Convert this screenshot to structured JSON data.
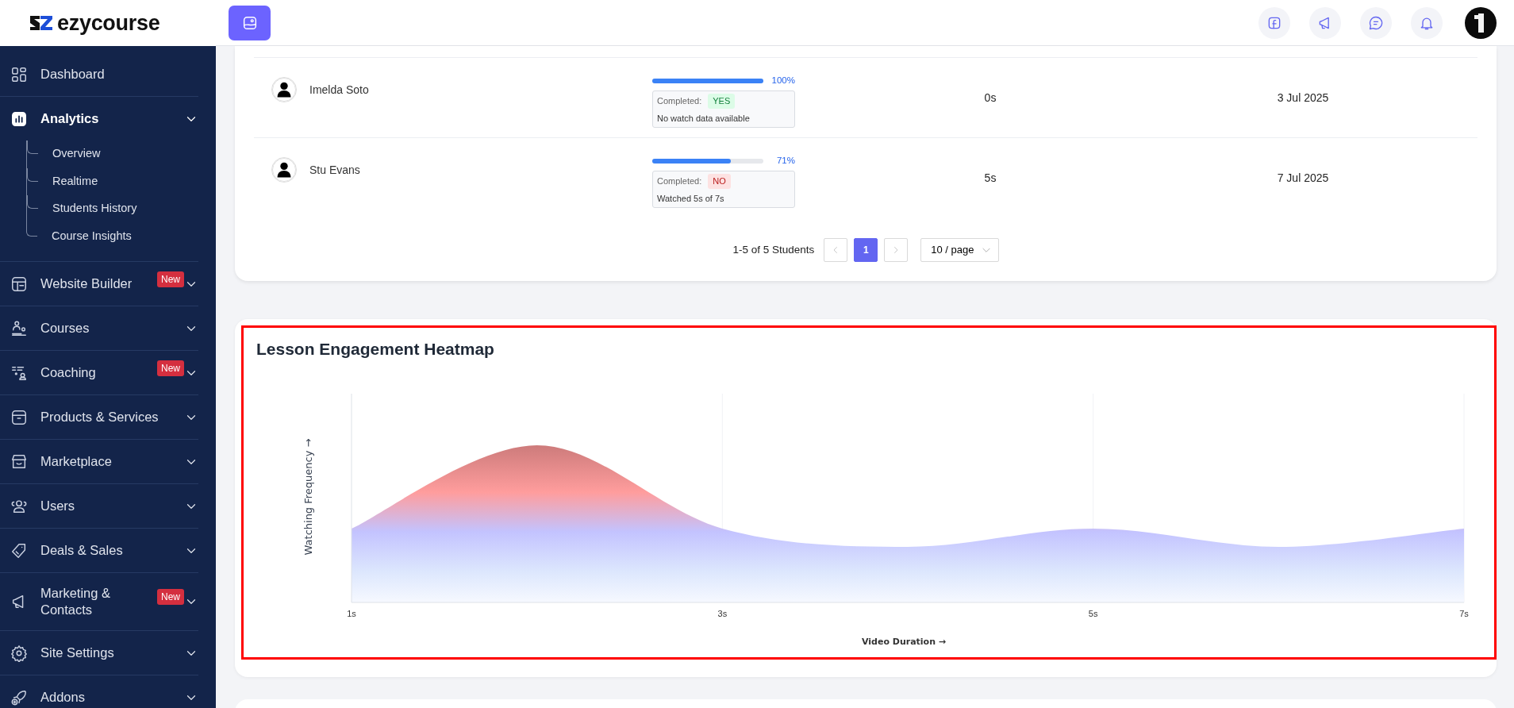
{
  "logo": {
    "text": "ezycourse"
  },
  "sidebar": {
    "items": [
      {
        "label": "Dashboard",
        "selected": false,
        "submenu": false
      },
      {
        "label": "Analytics",
        "selected": true,
        "submenu": true,
        "children": [
          {
            "label": "Overview"
          },
          {
            "label": "Realtime"
          },
          {
            "label": "Students History"
          },
          {
            "label": "Course Insights"
          }
        ]
      },
      {
        "label": "Website Builder",
        "selected": false,
        "submenu": true,
        "badge": "New"
      },
      {
        "label": "Courses",
        "selected": false,
        "submenu": true
      },
      {
        "label": "Coaching",
        "selected": false,
        "submenu": true,
        "badge": "New"
      },
      {
        "label": "Products & Services",
        "selected": false,
        "submenu": true
      },
      {
        "label": "Marketplace",
        "selected": false,
        "submenu": true
      },
      {
        "label": "Users",
        "selected": false,
        "submenu": true
      },
      {
        "label": "Deals & Sales",
        "selected": false,
        "submenu": true
      },
      {
        "label": "Marketing & Contacts",
        "selected": false,
        "submenu": true,
        "badge": "New"
      },
      {
        "label": "Site Settings",
        "selected": false,
        "submenu": true
      },
      {
        "label": "Addons",
        "selected": false,
        "submenu": true
      }
    ]
  },
  "students": {
    "rows": [
      {
        "name": "Imelda Soto",
        "level": 1,
        "percent": "100%",
        "completed_label": "Completed:",
        "completed": true,
        "status": "YES",
        "note": "No watch data available",
        "time": "0s",
        "date": "3 Jul 2025"
      },
      {
        "name": "Stu Evans",
        "level": 0.71,
        "percent": "71%",
        "completed_label": "Completed:",
        "completed": false,
        "status": "NO",
        "note": "Watched 5s of 7s",
        "time": "5s",
        "date": "7 Jul 2025"
      }
    ]
  },
  "pagination": {
    "summary": "1-5 of 5 Students",
    "prev_disabled": true,
    "next_disabled": true,
    "pages": [
      {
        "label": "1",
        "selected": true
      }
    ],
    "page_size": "10 / page"
  },
  "heatmap": {
    "title": "Lesson Engagement Heatmap",
    "highlighted": true,
    "ylabel": "Watching Frequency →",
    "xlabel": "Video Duration →",
    "xticks": [
      "1s",
      "3s",
      "5s",
      "7s"
    ]
  }
}
